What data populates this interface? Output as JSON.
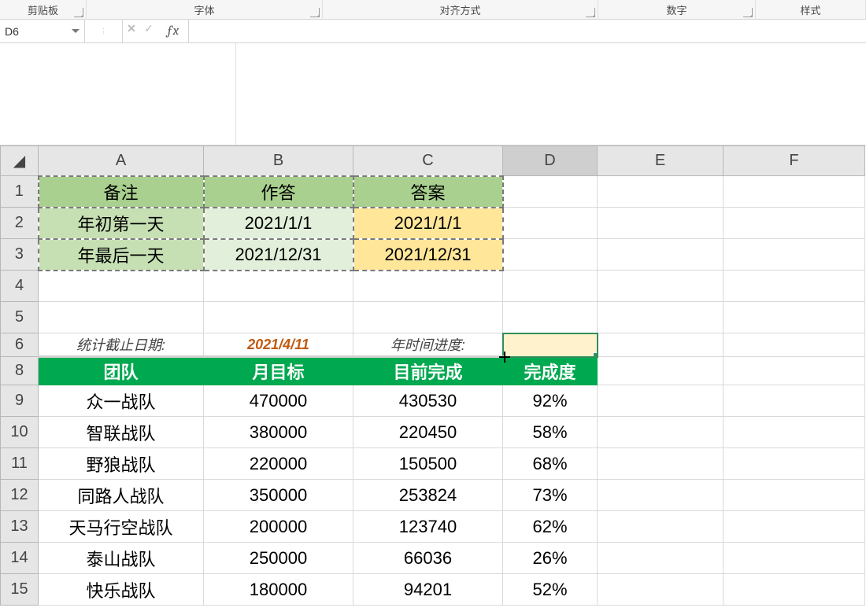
{
  "ribbon": {
    "groups": [
      "剪贴板",
      "字体",
      "对齐方式",
      "数字",
      "样式"
    ]
  },
  "namebox": "D6",
  "formula": "",
  "columns": [
    "A",
    "B",
    "C",
    "D",
    "E",
    "F"
  ],
  "row_numbers": [
    1,
    2,
    3,
    4,
    5,
    6,
    8,
    9,
    10,
    11,
    12,
    13,
    14,
    15
  ],
  "block": {
    "headers": [
      "备注",
      "作答",
      "答案"
    ],
    "rows": [
      {
        "label": "年初第一天",
        "answer_given": "2021/1/1",
        "answer_key": "2021/1/1"
      },
      {
        "label": "年最后一天",
        "answer_given": "2021/12/31",
        "answer_key": "2021/12/31"
      }
    ]
  },
  "row6": {
    "stat_label": "统计截止日期:",
    "stat_date": "2021/4/11",
    "progress_label": "年时间进度:",
    "progress_value": ""
  },
  "table": {
    "headers": [
      "团队",
      "月目标",
      "目前完成",
      "完成度"
    ],
    "rows": [
      {
        "team": "众一战队",
        "target": "470000",
        "done": "430530",
        "pct": "92%"
      },
      {
        "team": "智联战队",
        "target": "380000",
        "done": "220450",
        "pct": "58%"
      },
      {
        "team": "野狼战队",
        "target": "220000",
        "done": "150500",
        "pct": "68%"
      },
      {
        "team": "同路人战队",
        "target": "350000",
        "done": "253824",
        "pct": "73%"
      },
      {
        "team": "天马行空战队",
        "target": "200000",
        "done": "123740",
        "pct": "62%"
      },
      {
        "team": "泰山战队",
        "target": "250000",
        "done": "66036",
        "pct": "26%"
      },
      {
        "team": "快乐战队",
        "target": "180000",
        "done": "94201",
        "pct": "52%"
      }
    ]
  },
  "icons": {
    "dropdown": "chevron-down"
  }
}
